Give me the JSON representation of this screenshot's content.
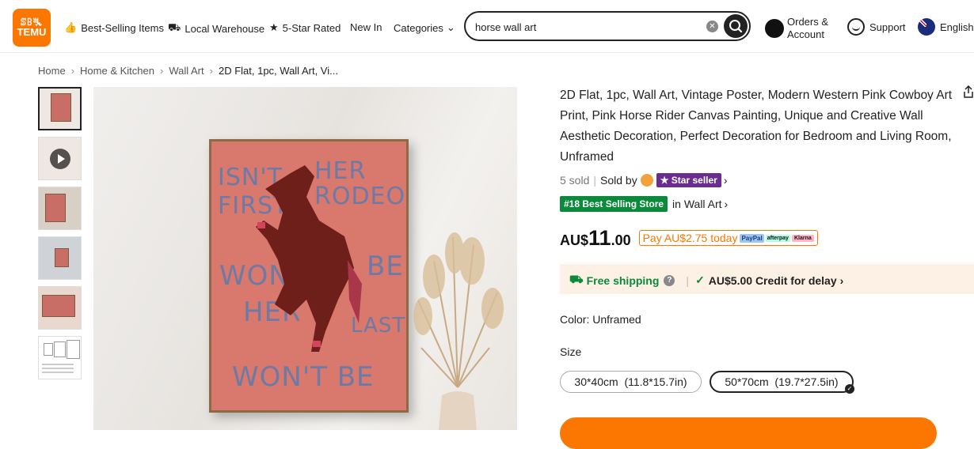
{
  "header": {
    "logo_line1": "ꕷꕗꔩ",
    "logo_line2": "TEMU",
    "nav": [
      {
        "label": "Best-Selling Items",
        "icon": "thumbs-up-icon"
      },
      {
        "label": "Local Warehouse",
        "icon": "truck-icon"
      },
      {
        "label": "5-Star Rated",
        "icon": "star-badge-icon"
      },
      {
        "label": "New In",
        "icon": ""
      },
      {
        "label": "Categories",
        "icon": "chevron-down-icon"
      }
    ],
    "search_value": "horse wall art",
    "orders_line1": "Orders &",
    "orders_line2": "Account",
    "support": "Support",
    "language": "English"
  },
  "breadcrumb": [
    "Home",
    "Home & Kitchen",
    "Wall Art",
    "2D Flat, 1pc, Wall Art, Vi..."
  ],
  "product": {
    "title": "2D Flat, 1pc, Wall Art, Vintage Poster, Modern Western Pink Cowboy Art Print, Pink Horse Rider Canvas Painting, Unique and Creative Wall Aesthetic Decoration, Perfect Decoration for Bedroom and Living Room, Unframed",
    "sold": "5 sold",
    "sold_by": "Sold by",
    "star_seller": "Star seller",
    "rank_badge": "#18 Best Selling Store",
    "rank_in": "in Wall Art",
    "price_currency": "AU$",
    "price_int": "11",
    "price_dec": ".00",
    "pay_later": "Pay AU$2.75 today",
    "pay_paypal": "PayPal",
    "pay_afterpay": "afterpay",
    "pay_klarna": "Klarna",
    "free_shipping": "Free shipping",
    "credit": "AU$5.00 Credit for delay",
    "color_label": "Color: Unframed",
    "size_label": "Size",
    "sizes": [
      {
        "label": "30*40cm  (11.8*15.7in)",
        "selected": false
      },
      {
        "label": "50*70cm  (19.7*27.5in)",
        "selected": true
      }
    ]
  },
  "poster_text": {
    "l1a": "ISN'T",
    "l1b": "HER",
    "l2a": "FIRST",
    "l2b": "RODEO",
    "l3a": "WON'T",
    "l3b": "BE",
    "l4a": "HER",
    "l4b": "LAST",
    "l5": "WON'T BE"
  },
  "colors": {
    "brand": "#fb7701",
    "rank": "#0a8a3a",
    "star_seller": "#6b2c91"
  }
}
